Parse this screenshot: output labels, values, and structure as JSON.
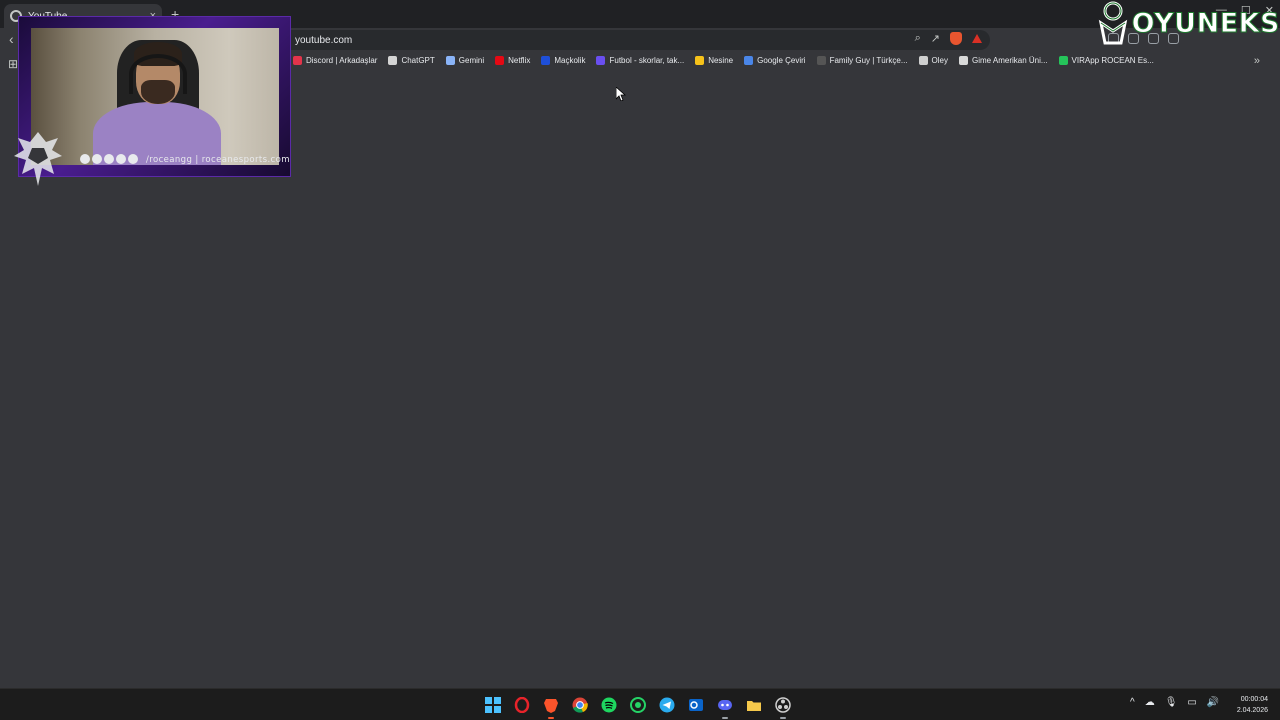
{
  "browser": {
    "tab_title": "YouTube",
    "tab_close": "×",
    "new_tab": "+",
    "url": "youtube.com",
    "back_icon": "chevron-left-icon"
  },
  "window_controls": {
    "minimize": "—",
    "maximize": "☐",
    "close": "✕"
  },
  "bookmarks": [
    {
      "label": "Discord | Arkadaşlar",
      "color": "#e3344b"
    },
    {
      "label": "ChatGPT",
      "color": "#d4d4d4"
    },
    {
      "label": "Gemini",
      "color": "#8ab4f8"
    },
    {
      "label": "Netflix",
      "color": "#e50914"
    },
    {
      "label": "Maçkolik",
      "color": "#1e4fd8"
    },
    {
      "label": "Futbol - skorlar, tak...",
      "color": "#6a4ff0"
    },
    {
      "label": "Nesine",
      "color": "#f6c21a"
    },
    {
      "label": "Google Çeviri",
      "color": "#4a86e8"
    },
    {
      "label": "Family Guy | Türkçe...",
      "color": "#555555"
    },
    {
      "label": "Oley",
      "color": "#cfcfcf"
    },
    {
      "label": "Gime Amerikan Üni...",
      "color": "#d9d9d9"
    },
    {
      "label": "VIRApp ROCEAN Es...",
      "color": "#25c45a"
    }
  ],
  "bookmarks_more": "»",
  "overlay": {
    "socials_handle": "/roceangg | roceanesports.com",
    "brand_text": "OYUNEKS"
  },
  "taskbar": {
    "apps": [
      "windows-start",
      "opera",
      "brave",
      "chrome",
      "spotify",
      "whatsapp",
      "telegram",
      "outlook",
      "discord",
      "file-explorer",
      "obs"
    ],
    "tray_chevron": "^",
    "time": "00:00:04",
    "date": "2.04.2026"
  },
  "colors": {
    "brand_green": "#1e7a2e",
    "overlay_purple": "#4a1d8f"
  }
}
